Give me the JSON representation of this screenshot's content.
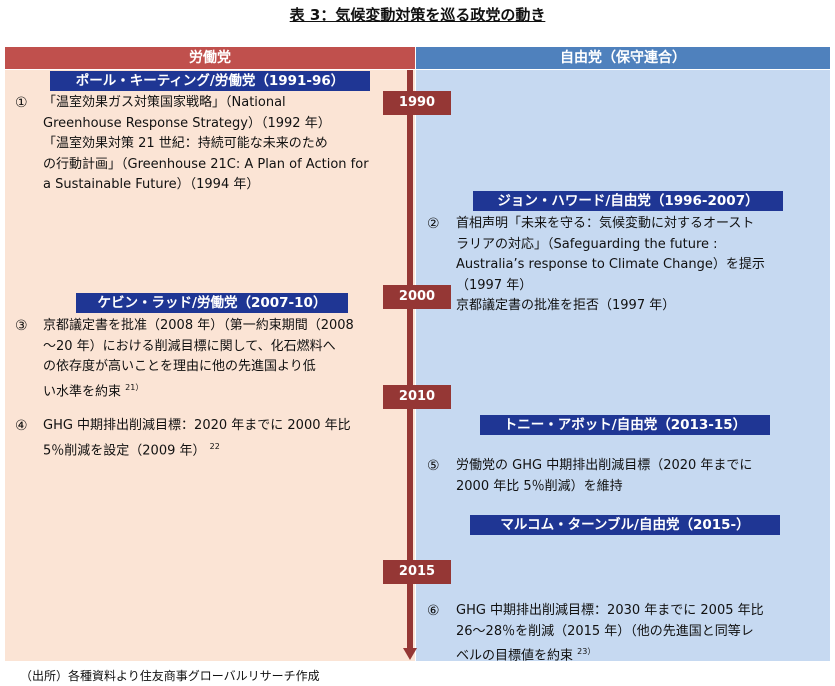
{
  "title": "表 3：気候変動対策を巡る政党の動き",
  "headers": {
    "labor": "労働党",
    "liberal": "自由党（保守連合）"
  },
  "bands": {
    "keating": "ポール・キーティング/労働党（1991-96）",
    "howard": "ジョン・ハワード/自由党（1996-2007）",
    "rudd": "ケビン・ラッド/労働党（2007-10）",
    "abbott": "トニー・アボット/自由党（2013-15）",
    "turnbull": "マルコム・ターンブル/自由党（2015-）"
  },
  "years": [
    "1990",
    "2000",
    "2010",
    "2015"
  ],
  "items": {
    "i1": {
      "num": "①",
      "lines": [
        "「温室効果ガス対策国家戦略」（National",
        "Greenhouse Response Strategy）（1992 年）",
        "「温室効果対策 21 世紀：持続可能な未来のため",
        "の行動計画」（Greenhouse 21C: A Plan of Action for",
        "a Sustainable Future）（1994 年）"
      ]
    },
    "i2": {
      "num": "②",
      "lines": [
        "首相声明「未来を守る：気候変動に対するオースト",
        "ラリアの対応」（Safeguarding the future :",
        "Australia’s response to Climate Change）を提示",
        "（1997 年）",
        "京都議定書の批准を拒否（1997 年）"
      ]
    },
    "i3": {
      "num": "③",
      "lines": [
        "京都議定書を批准（2008 年）（第一約束期間（2008",
        "～20 年）における削減目標に関して、化石燃料へ",
        "の依存度が高いことを理由に他の先進国より低",
        "い水準を約束"
      ],
      "sup": "21）"
    },
    "i4": {
      "num": "④",
      "lines": [
        "GHG 中期排出削減目標：2020 年までに 2000 年比",
        "5％削減を設定（2009 年）"
      ],
      "sup": "22"
    },
    "i5": {
      "num": "⑤",
      "lines": [
        "労働党の GHG 中期排出削減目標（2020 年までに",
        "2000 年比 5％削減）を維持"
      ]
    },
    "i6": {
      "num": "⑥",
      "lines": [
        "GHG 中期排出削減目標：2030 年までに 2005 年比",
        "26～28％を削減（2015 年）（他の先進国と同等レ",
        "ベルの目標値を約束"
      ],
      "sup": "23）"
    }
  },
  "source": "（出所）各種資料より住友商事グローバルリサーチ作成"
}
